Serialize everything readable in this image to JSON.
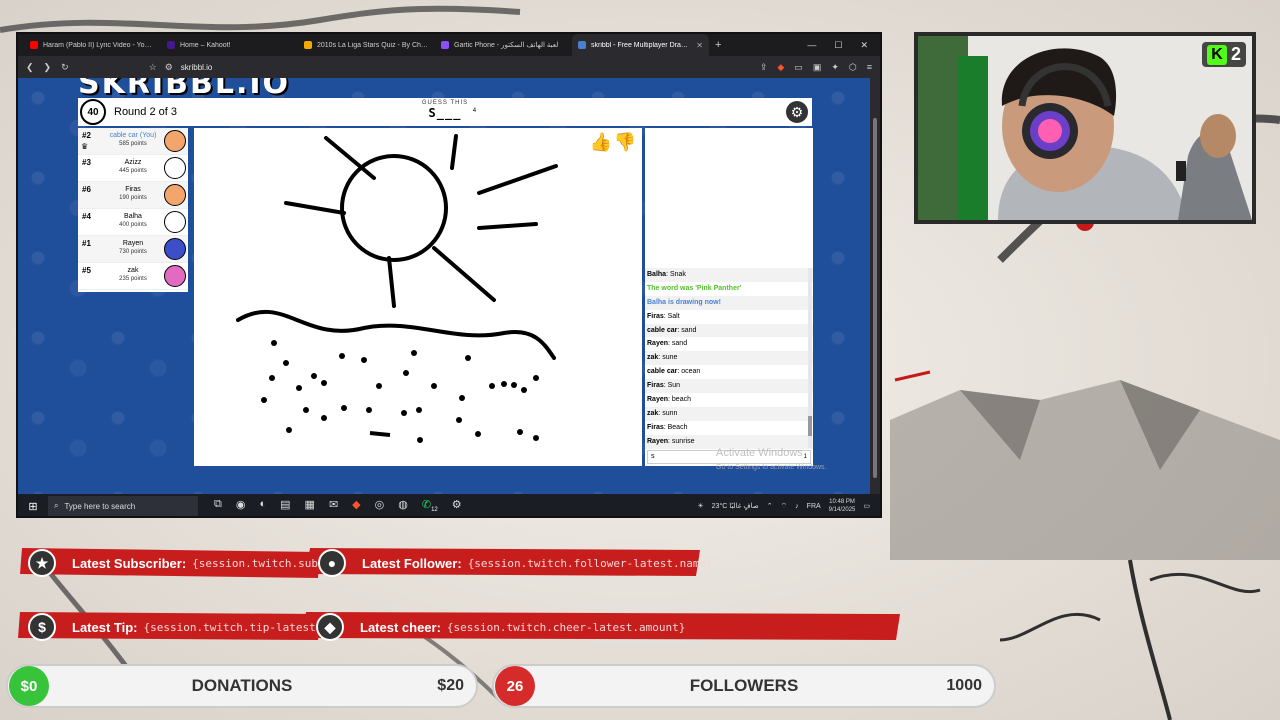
{
  "browser": {
    "tabs": [
      {
        "title": "Haram (Pablo II) Lyric Video - YouTube",
        "color": "#ff0000",
        "active": false
      },
      {
        "title": "Home – Kahoot!",
        "color": "#46178f",
        "active": false
      },
      {
        "title": "2010s La Liga Stars Quiz - By Chilaws",
        "color": "#f2a900",
        "active": false
      },
      {
        "title": "Gartic Phone - لعبة الهاتف السكتور",
        "color": "#8a4fff",
        "active": false
      },
      {
        "title": "skribbl - Free Multiplayer Drawing",
        "color": "#4a80d1",
        "active": true
      }
    ],
    "new_tab": "+",
    "url": "skribbl.io"
  },
  "game": {
    "logo": "SKRIBBL.IO",
    "timer": "40",
    "round": "Round 2 of 3",
    "guess_label": "GUESS THIS",
    "word": "S___",
    "word_length": "4",
    "players": [
      {
        "rank": "#2",
        "name": "cable car (You)",
        "points": "585 points",
        "me": true,
        "crown": true,
        "color": "#f3a56b"
      },
      {
        "rank": "#3",
        "name": "Azizz",
        "points": "445 points",
        "me": false,
        "color": "#ffffff"
      },
      {
        "rank": "#6",
        "name": "Firas",
        "points": "190 points",
        "me": false,
        "color": "#f3a56b"
      },
      {
        "rank": "#4",
        "name": "Balha",
        "points": "400 points",
        "me": false,
        "color": "#ffffff"
      },
      {
        "rank": "#1",
        "name": "Rayen",
        "points": "730 points",
        "me": false,
        "color": "#3d4ec9"
      },
      {
        "rank": "#5",
        "name": "zak",
        "points": "235 points",
        "me": false,
        "color": "#e26bc1"
      }
    ],
    "chat": [
      {
        "user": "Balha",
        "text": "Snak",
        "type": "normal"
      },
      {
        "user": "",
        "text": "The word was 'Pink Panther'",
        "type": "green"
      },
      {
        "user": "",
        "text": "Balha is drawing now!",
        "type": "blue"
      },
      {
        "user": "Firas",
        "text": "Salt",
        "type": "normal"
      },
      {
        "user": "cable car",
        "text": "sand",
        "type": "normal"
      },
      {
        "user": "Rayen",
        "text": "sand",
        "type": "normal"
      },
      {
        "user": "zak",
        "text": "sune",
        "type": "normal"
      },
      {
        "user": "cable car",
        "text": "ocean",
        "type": "normal"
      },
      {
        "user": "Firas",
        "text": "Sun",
        "type": "normal"
      },
      {
        "user": "Rayen",
        "text": "beach",
        "type": "normal"
      },
      {
        "user": "zak",
        "text": "sunn",
        "type": "normal"
      },
      {
        "user": "Firas",
        "text": "Beach",
        "type": "normal"
      },
      {
        "user": "Rayen",
        "text": "sunrise",
        "type": "normal"
      }
    ],
    "chat_input_value": "s",
    "chat_input_count": "1",
    "activate_title": "Activate Windows",
    "activate_sub": "Go to Settings to activate Windows."
  },
  "taskbar": {
    "search_placeholder": "Type here to search",
    "weather": "23°C صافٍ غالبًا",
    "lang": "FRA",
    "time": "10:48 PM",
    "date": "9/14/2025",
    "whatsapp_badge": "12"
  },
  "webcam": {
    "kick_count": "2"
  },
  "overlay": {
    "subscriber_label": "Latest Subscriber:",
    "subscriber_value": "{session.twitch.subsc",
    "follower_label": "Latest Follower:",
    "follower_value": "{session.twitch.follower-latest.name}",
    "tip_label": "Latest Tip:",
    "tip_value": "{session.twitch.tip-latest.",
    "cheer_label": "Latest cheer:",
    "cheer_value": "{session.twitch.cheer-latest.amount}",
    "donations": {
      "current": "$0",
      "title": "DONATIONS",
      "goal": "$20"
    },
    "followers": {
      "current": "26",
      "title": "FOLLOWERS",
      "goal": "1000"
    }
  }
}
